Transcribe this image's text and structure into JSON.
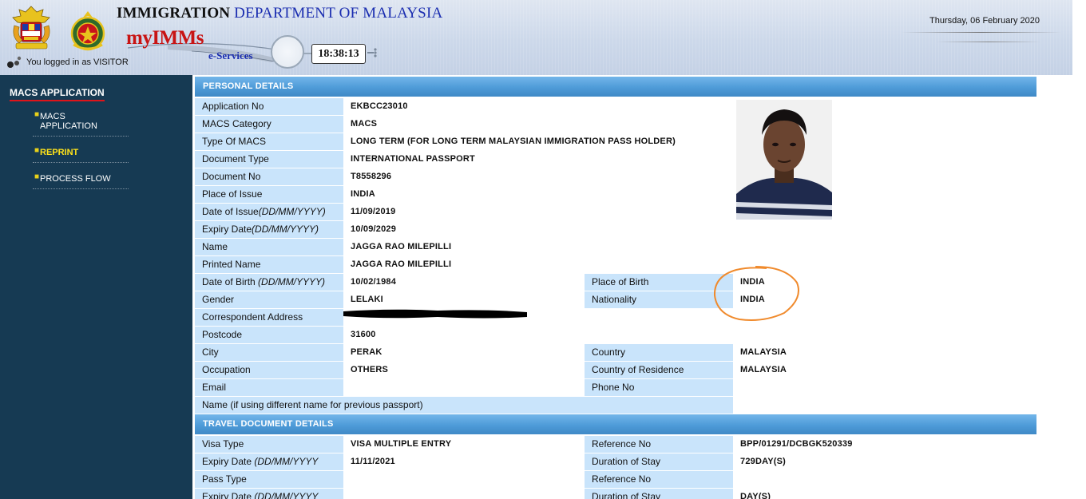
{
  "header": {
    "dept_name_bold": "IMMIGRATION",
    "dept_name_rest": " DEPARTMENT OF MALAYSIA",
    "brand": "myIMMs",
    "sub_brand": "e-Services",
    "clock_time": "18:38:13",
    "login_status": "You logged in as VISITOR",
    "date": "Thursday, 06 February 2020"
  },
  "sidebar": {
    "title": "MACS APPLICATION",
    "items": [
      {
        "label": "MACS APPLICATION"
      },
      {
        "label": "REPRINT"
      },
      {
        "label": "PROCESS FLOW"
      }
    ]
  },
  "personal": {
    "heading": "PERSONAL DETAILS",
    "application_no": {
      "label": "Application No",
      "value": "EKBCC23010"
    },
    "macs_category": {
      "label": "MACS Category",
      "value": "MACS"
    },
    "type_of_macs": {
      "label": "Type Of MACS",
      "value": "LONG TERM (FOR LONG TERM MALAYSIAN IMMIGRATION PASS HOLDER)"
    },
    "document_type": {
      "label": "Document Type",
      "value": "INTERNATIONAL PASSPORT"
    },
    "document_no": {
      "label": "Document No",
      "value": "T8558296"
    },
    "place_of_issue": {
      "label": "Place of Issue",
      "value": "INDIA"
    },
    "date_of_issue": {
      "label": "Date of Issue",
      "fmt": "(DD/MM/YYYY)",
      "value": "11/09/2019"
    },
    "expiry_date": {
      "label": "Expiry Date",
      "fmt": "(DD/MM/YYYY)",
      "value": "10/09/2029"
    },
    "name": {
      "label": "Name",
      "value": "JAGGA RAO MILEPILLI"
    },
    "printed_name": {
      "label": "Printed Name",
      "value": "JAGGA RAO MILEPILLI"
    },
    "date_of_birth": {
      "label": "Date of Birth ",
      "fmt": "(DD/MM/YYYY)",
      "value": "10/02/1984"
    },
    "place_of_birth": {
      "label": "Place of Birth",
      "value": "INDIA"
    },
    "gender": {
      "label": "Gender",
      "value": "LELAKI"
    },
    "nationality": {
      "label": "Nationality",
      "value": "INDIA"
    },
    "correspondent_address": {
      "label": "Correspondent Address",
      "value": ""
    },
    "postcode": {
      "label": "Postcode",
      "value": "31600"
    },
    "city": {
      "label": "City",
      "value": "PERAK"
    },
    "country": {
      "label": "Country",
      "value": "MALAYSIA"
    },
    "occupation": {
      "label": "Occupation",
      "value": "OTHERS"
    },
    "country_of_residence": {
      "label": "Country of Residence",
      "value": "MALAYSIA"
    },
    "email": {
      "label": "Email",
      "value": ""
    },
    "phone_no": {
      "label": "Phone No",
      "value": ""
    },
    "prev_name": {
      "label": "Name (if using different name for previous passport)",
      "value": ""
    }
  },
  "travel": {
    "heading": "TRAVEL DOCUMENT DETAILS",
    "visa_type": {
      "label": "Visa Type",
      "value": "VISA MULTIPLE ENTRY"
    },
    "reference_no_1": {
      "label": "Reference No",
      "value": "BPP/01291/DCBGK520339"
    },
    "expiry_date_1": {
      "label": "Expiry Date ",
      "fmt": "(DD/MM/YYYY",
      "value": "11/11/2021"
    },
    "duration_1": {
      "label": "Duration of Stay",
      "value": "729DAY(S)"
    },
    "pass_type": {
      "label": "Pass Type",
      "value": ""
    },
    "reference_no_2": {
      "label": "Reference No",
      "value": ""
    },
    "expiry_date_2": {
      "label": "Expiry Date ",
      "fmt": "(DD/MM/YYYY",
      "value": ""
    },
    "duration_2": {
      "label": "Duration of Stay",
      "value": "DAY(S)"
    }
  },
  "colors": {
    "sidebar_bg": "#163a53",
    "section_header": "#4e9bd8",
    "label_bg": "#c9e4fb",
    "highlight_yellow": "#ffe21a",
    "annotation_orange": "#f08a2c"
  }
}
